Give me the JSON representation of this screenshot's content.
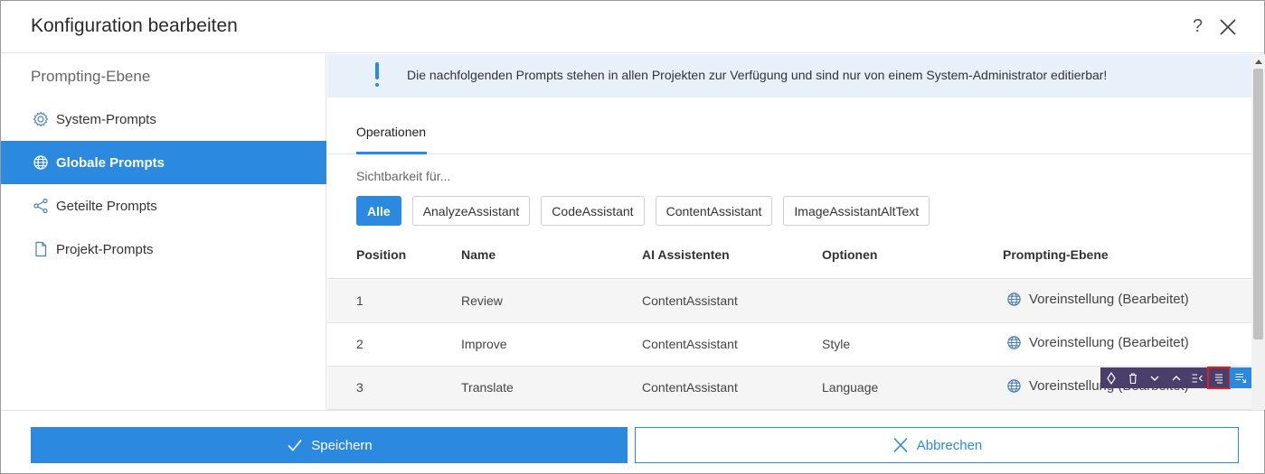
{
  "dialog": {
    "title": "Konfiguration bearbeiten",
    "help_label": "?"
  },
  "sidebar": {
    "title": "Prompting-Ebene",
    "items": [
      {
        "label": "System-Prompts",
        "icon": "gear-icon"
      },
      {
        "label": "Globale Prompts",
        "icon": "globe-icon",
        "active": true
      },
      {
        "label": "Geteilte Prompts",
        "icon": "share-icon"
      },
      {
        "label": "Projekt-Prompts",
        "icon": "document-icon"
      }
    ]
  },
  "info": {
    "message": "Die nachfolgenden Prompts stehen in allen Projekten zur Verfügung und sind nur von einem System-Administrator editierbar!"
  },
  "tabs": [
    {
      "label": "Operationen",
      "active": true
    }
  ],
  "filter": {
    "label": "Sichtbarkeit für...",
    "options": [
      "Alle",
      "AnalyzeAssistant",
      "CodeAssistant",
      "ContentAssistant",
      "ImageAssistantAltText"
    ],
    "selected": "Alle"
  },
  "table": {
    "columns": [
      "Position",
      "Name",
      "AI Assistenten",
      "Optionen",
      "Prompting-Ebene"
    ],
    "rows": [
      {
        "position": "1",
        "name": "Review",
        "assistant": "ContentAssistant",
        "options": "",
        "level": "Voreinstellung (Bearbeitet)"
      },
      {
        "position": "2",
        "name": "Improve",
        "assistant": "ContentAssistant",
        "options": "Style",
        "level": "Voreinstellung (Bearbeitet)"
      },
      {
        "position": "3",
        "name": "Translate",
        "assistant": "ContentAssistant",
        "options": "Language",
        "level": "Voreinstellung (Bearbeitet)"
      }
    ]
  },
  "row_toolbar": {
    "buttons": [
      "move-icon",
      "delete-icon",
      "chevron-down-icon",
      "chevron-up-icon",
      "outdent-icon",
      "align-lines-icon",
      "insert-below-icon"
    ],
    "highlighted": "align-lines-icon"
  },
  "footer": {
    "save_label": "Speichern",
    "cancel_label": "Abbrechen"
  },
  "colors": {
    "accent": "#2b8ae0",
    "toolbar_bg": "#4a3f6b",
    "info_bg": "#e8f1fa",
    "highlight": "#e02020"
  }
}
